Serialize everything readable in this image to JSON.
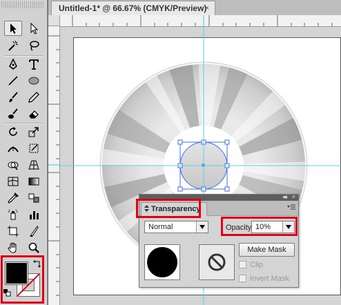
{
  "document": {
    "tab_title": "Untitled-1* @ 66.67% (CMYK/Preview)",
    "close_glyph": "×"
  },
  "tools": [
    {
      "name": "selection-tool",
      "icon": "arrow-icon"
    },
    {
      "name": "direct-selection-tool",
      "icon": "hollow-arrow-icon"
    },
    {
      "name": "magic-wand-tool",
      "icon": "wand-icon"
    },
    {
      "name": "lasso-tool",
      "icon": "lasso-icon"
    },
    {
      "name": "pen-tool",
      "icon": "pen-icon"
    },
    {
      "name": "type-tool",
      "icon": "type-icon"
    },
    {
      "name": "line-segment-tool",
      "icon": "line-icon"
    },
    {
      "name": "ellipse-tool",
      "icon": "ellipse-icon"
    },
    {
      "name": "paintbrush-tool",
      "icon": "brush-icon"
    },
    {
      "name": "pencil-tool",
      "icon": "pencil-icon"
    },
    {
      "name": "blob-brush-tool",
      "icon": "blob-brush-icon"
    },
    {
      "name": "eraser-tool",
      "icon": "eraser-icon"
    },
    {
      "name": "rotate-tool",
      "icon": "rotate-icon"
    },
    {
      "name": "scale-tool",
      "icon": "scale-icon"
    },
    {
      "name": "width-tool",
      "icon": "width-icon"
    },
    {
      "name": "free-transform-tool",
      "icon": "free-transform-icon"
    },
    {
      "name": "shape-builder-tool",
      "icon": "shape-builder-icon"
    },
    {
      "name": "perspective-grid-tool",
      "icon": "perspective-icon"
    },
    {
      "name": "mesh-tool",
      "icon": "mesh-icon"
    },
    {
      "name": "gradient-tool",
      "icon": "gradient-icon"
    },
    {
      "name": "eyedropper-tool",
      "icon": "eyedropper-icon"
    },
    {
      "name": "blend-tool",
      "icon": "blend-icon"
    },
    {
      "name": "symbol-sprayer-tool",
      "icon": "spray-icon"
    },
    {
      "name": "column-graph-tool",
      "icon": "graph-icon"
    },
    {
      "name": "artboard-tool",
      "icon": "artboard-icon"
    },
    {
      "name": "slice-tool",
      "icon": "slice-icon"
    },
    {
      "name": "hand-tool",
      "icon": "hand-icon"
    },
    {
      "name": "zoom-tool",
      "icon": "zoom-icon"
    }
  ],
  "colors": {
    "fill": "#000000",
    "stroke": "none",
    "highlight": "#e1001a",
    "guide": "#4fd5e6",
    "selection": "#3b6cf0"
  },
  "transparency_panel": {
    "tab_label": "Transparency",
    "blend_mode": "Normal",
    "opacity_label": "Opacity:",
    "opacity_value": "10%",
    "make_mask_label": "Make Mask",
    "clip_label": "Clip",
    "invert_mask_label": "Invert Mask",
    "clip_checked": false,
    "invert_mask_checked": false,
    "collapse_glyph": "◂◂",
    "close_glyph": "×"
  }
}
